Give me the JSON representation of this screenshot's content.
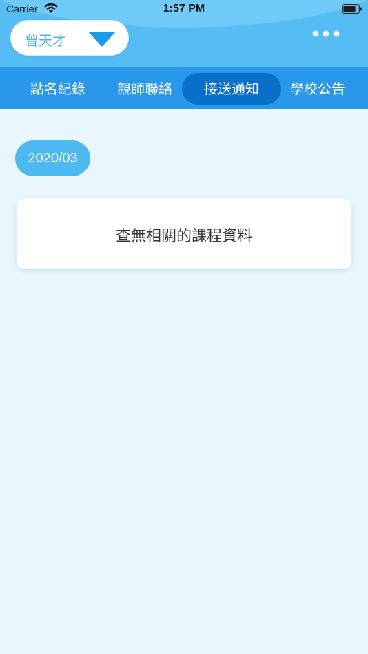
{
  "status_bar": {
    "carrier": "Carrier",
    "time": "1:57 PM"
  },
  "header": {
    "student_name": "曾天才",
    "more_icon": "ellipsis-icon"
  },
  "tabs": [
    {
      "label": "點名紀錄",
      "active": false
    },
    {
      "label": "親師聯絡",
      "active": false
    },
    {
      "label": "接送通知",
      "active": true
    },
    {
      "label": "學校公告",
      "active": false
    }
  ],
  "content": {
    "date": "2020/03",
    "empty_message": "查無相關的課程資料"
  },
  "colors": {
    "header_bg": "#56bdf4",
    "tabbar_bg": "#2a98ea",
    "tab_active_bg": "#0a6fc8",
    "date_chip_bg": "#4db9f1",
    "page_bg": "#eaf6fe"
  }
}
